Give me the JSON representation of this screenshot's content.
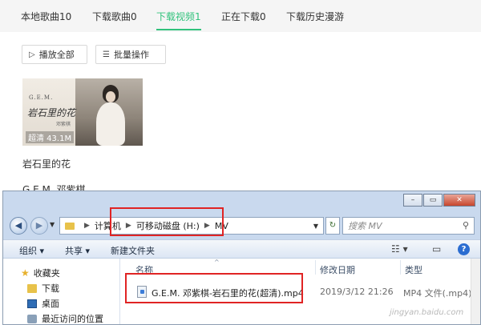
{
  "app": {
    "tabs": [
      {
        "label": "本地歌曲10",
        "active": false
      },
      {
        "label": "下载歌曲0",
        "active": false
      },
      {
        "label": "下载视频1",
        "active": true
      },
      {
        "label": "正在下载0",
        "active": false
      },
      {
        "label": "下载历史漫游",
        "active": false
      }
    ],
    "accent_color": "#31c27c",
    "play_all_label": "播放全部",
    "batch_label": "批量操作",
    "video": {
      "title": "岩石里的花",
      "artist": "G.E.M. 邓紫棋",
      "cover_brand": "G.E.M.",
      "cover_title": "岩石里的花",
      "cover_tag": "邓紫棋",
      "quality_label": "超清 43.1M"
    }
  },
  "explorer": {
    "address": {
      "root": "计算机",
      "drive": "可移动磁盘 (H:)",
      "folder": "MV"
    },
    "search_placeholder": "搜索 MV",
    "toolbar": {
      "organize": "组织 ▾",
      "share": "共享 ▾",
      "new_folder": "新建文件夹"
    },
    "nav": {
      "favorites": "收藏夹",
      "downloads": "下载",
      "desktop": "桌面",
      "recent": "最近访问的位置"
    },
    "columns": {
      "name": "名称",
      "date": "修改日期",
      "type": "类型"
    },
    "file": {
      "name": "G.E.M. 邓紫棋-岩石里的花(超清).mp4",
      "date": "2019/3/12 21:26",
      "type": "MP4 文件(.mp4)"
    },
    "highlight_color": "#e02424"
  },
  "watermark": "jingyan.baidu.com"
}
